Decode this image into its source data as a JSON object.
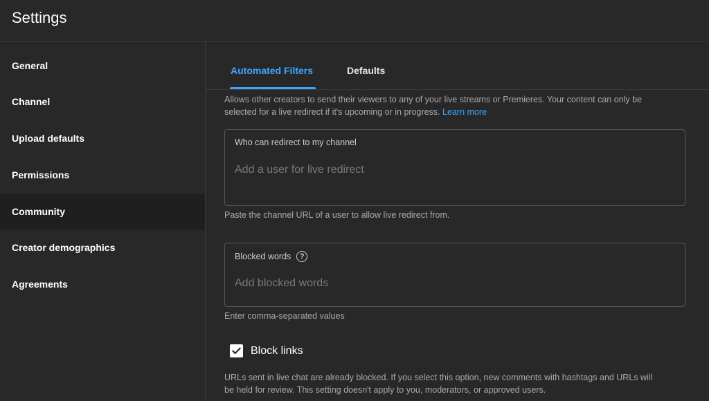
{
  "header": {
    "title": "Settings"
  },
  "sidebar": {
    "items": [
      {
        "label": "General"
      },
      {
        "label": "Channel"
      },
      {
        "label": "Upload defaults"
      },
      {
        "label": "Permissions"
      },
      {
        "label": "Community",
        "active": true
      },
      {
        "label": "Creator demographics"
      },
      {
        "label": "Agreements"
      }
    ]
  },
  "tabs": [
    {
      "label": "Automated Filters",
      "active": true
    },
    {
      "label": "Defaults",
      "active": false
    }
  ],
  "live_redirect": {
    "description_line1": "Allows other creators to send their viewers to any of your live streams or Premieres. Your content can only be",
    "description_line2": "selected for a live redirect if it's upcoming or in progress.",
    "learn_more": "Learn more",
    "field_label": "Who can redirect to my channel",
    "field_placeholder": "Add a user for live redirect",
    "help_text": "Paste the channel URL of a user to allow live redirect from."
  },
  "blocked_words": {
    "field_label": "Blocked words",
    "field_placeholder": "Add blocked words",
    "help_text": "Enter comma-separated values"
  },
  "block_links": {
    "label": "Block links",
    "checked": true,
    "description_line1": "URLs sent in live chat are already blocked. If you select this option, new comments with hashtags and URLs will",
    "description_line2": "be held for review. This setting doesn't apply to you, moderators, or approved users."
  },
  "colors": {
    "accent": "#3ea6ff",
    "background": "#282828",
    "active_nav": "#1f1f1f"
  }
}
